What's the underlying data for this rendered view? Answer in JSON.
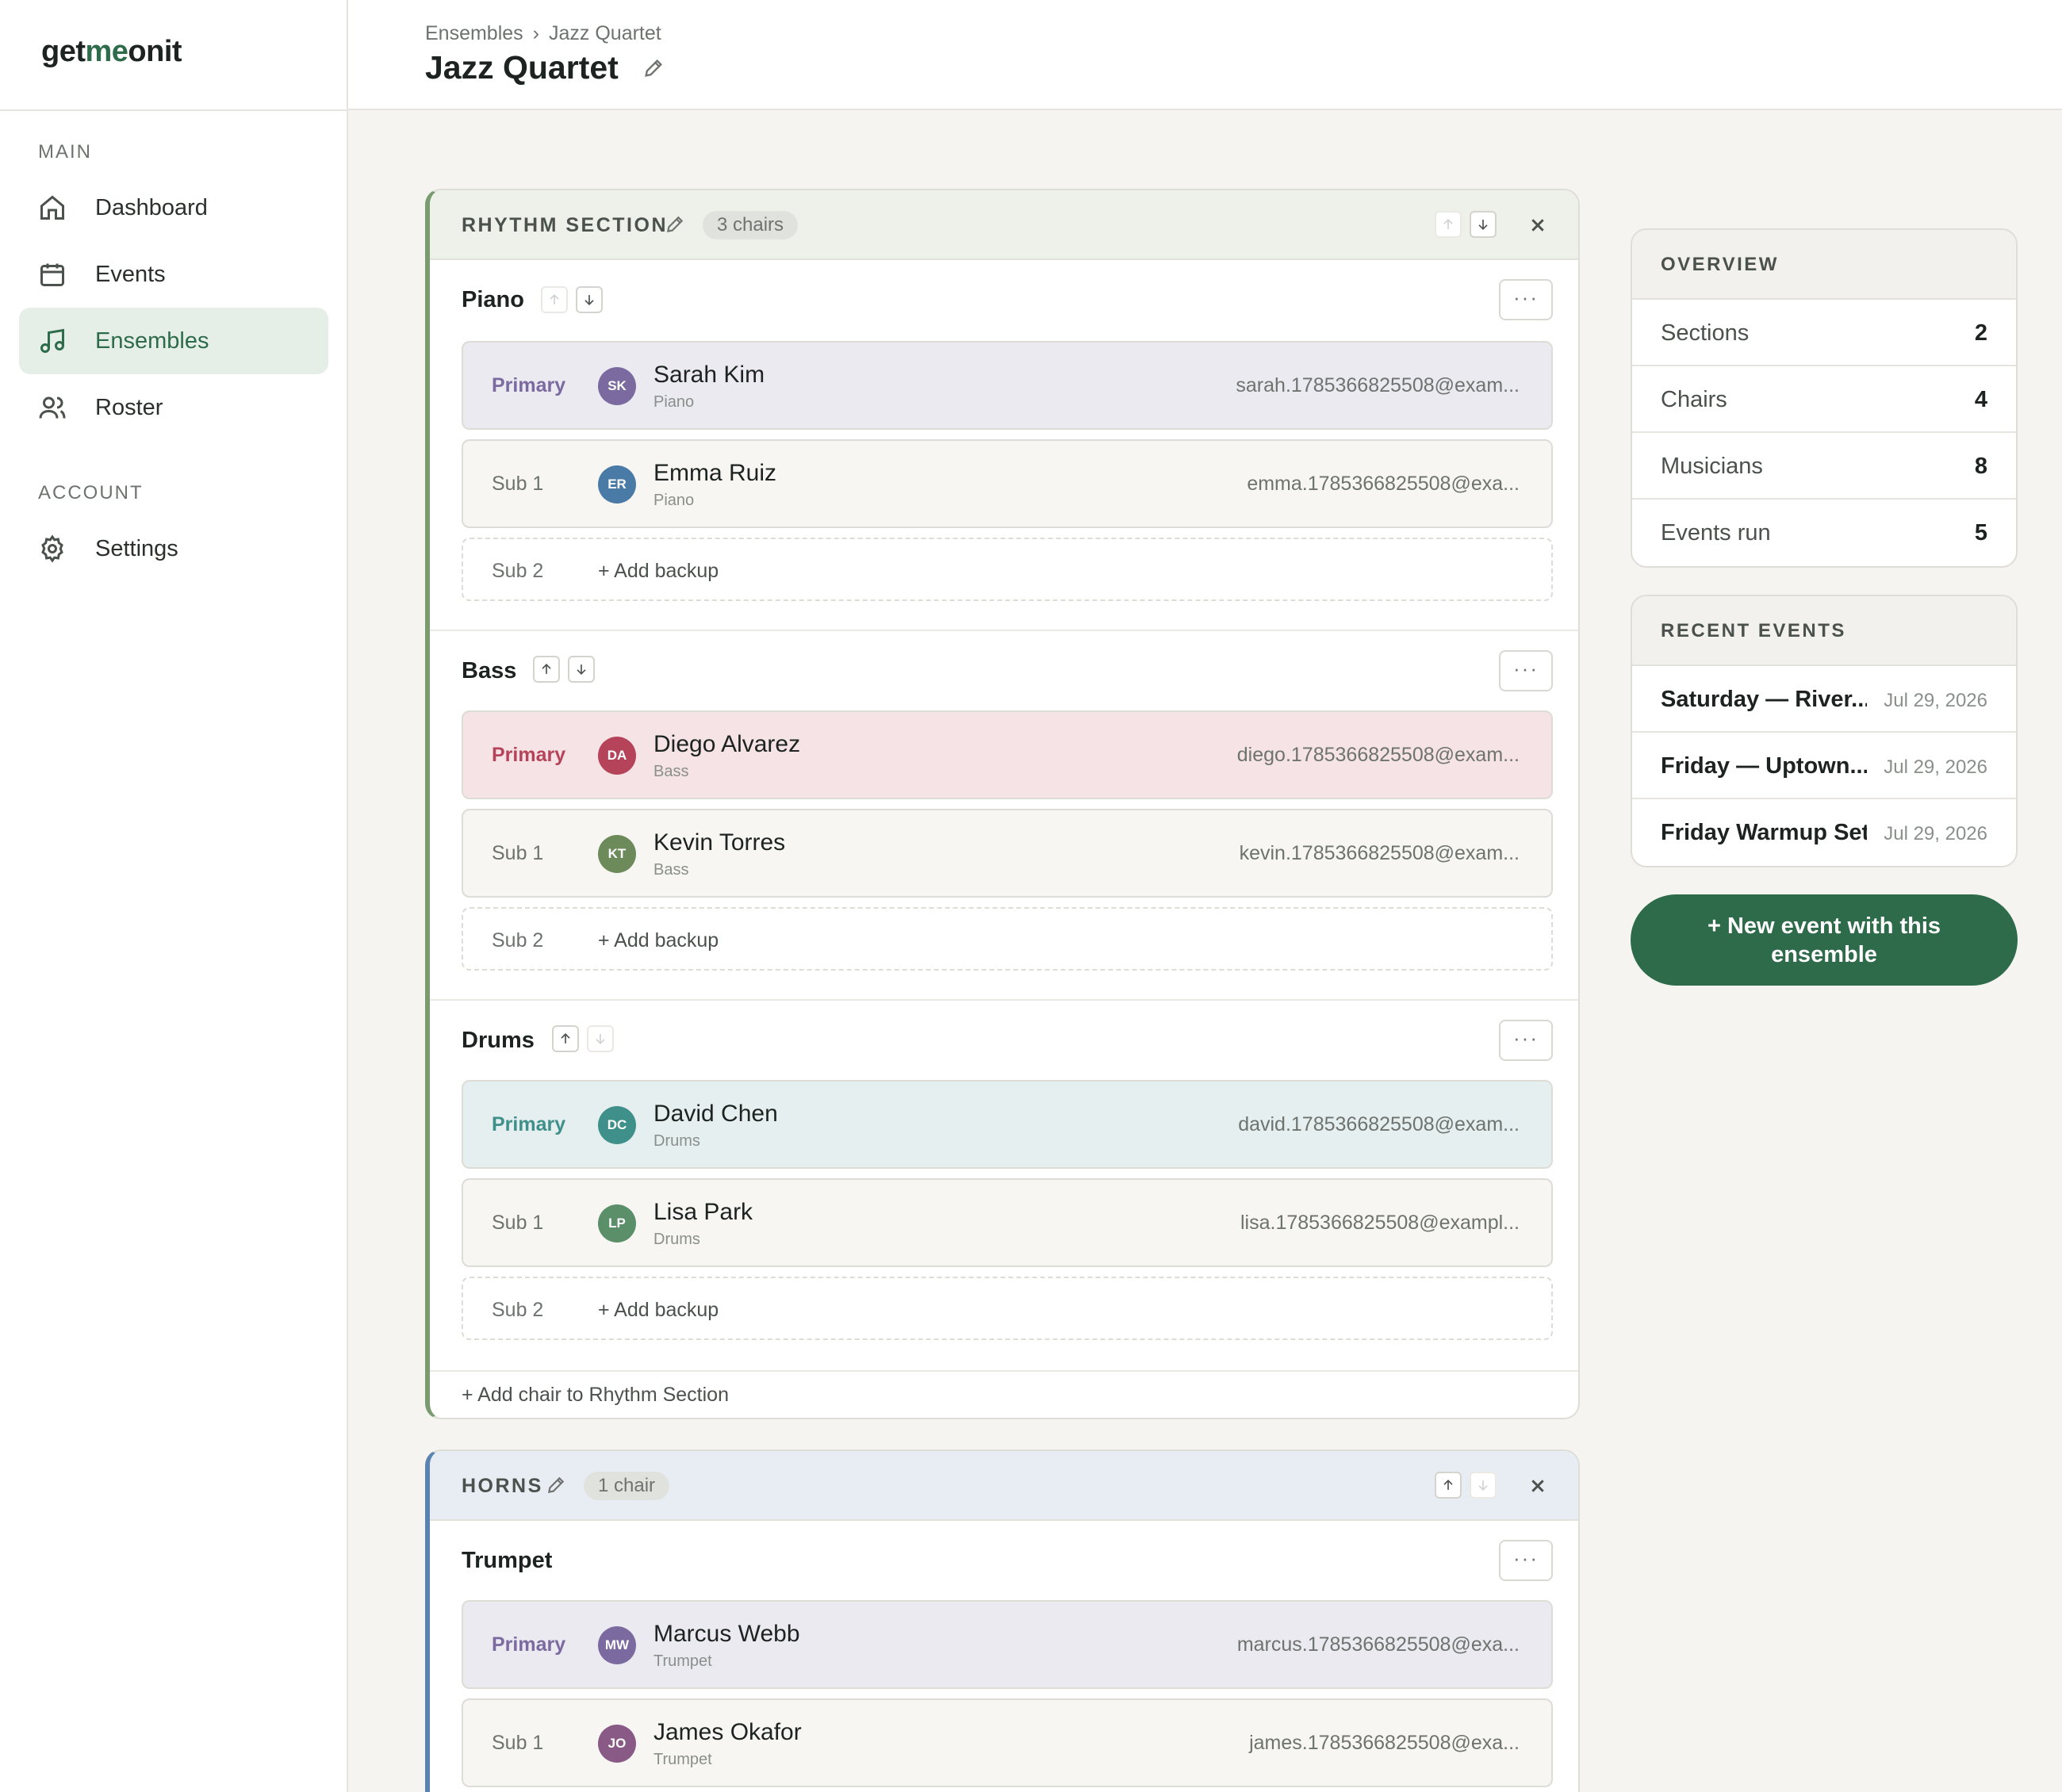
{
  "app": {
    "logo_pre": "get",
    "logo_mid": "me",
    "logo_post": "onit"
  },
  "sidebar": {
    "main_label": "MAIN",
    "account_label": "ACCOUNT",
    "items": [
      {
        "label": "Dashboard",
        "icon": "home-icon"
      },
      {
        "label": "Events",
        "icon": "calendar-icon"
      },
      {
        "label": "Ensembles",
        "icon": "music-note-icon",
        "active": true
      },
      {
        "label": "Roster",
        "icon": "users-icon"
      },
      {
        "label": "Settings",
        "icon": "gear-icon"
      }
    ]
  },
  "header": {
    "breadcrumb": [
      "Ensembles",
      "Jazz Quartet"
    ],
    "title": "Jazz Quartet"
  },
  "sections": [
    {
      "title": "RHYTHM SECTION",
      "count": "3 chairs",
      "accent": "#7a9a6f",
      "add_chair": "+ Add chair to Rhythm Section",
      "chairs": [
        {
          "name": "Piano",
          "seats": [
            {
              "role": "Primary",
              "initials": "SK",
              "name": "Sarah Kim",
              "instrument": "Piano",
              "email": "sarah.1785366825508@exam...",
              "color": "#7b6aa0"
            },
            {
              "role": "Sub 1",
              "initials": "ER",
              "name": "Emma Ruiz",
              "instrument": "Piano",
              "email": "emma.1785366825508@exa...",
              "color": "#4a7aa6"
            },
            {
              "role": "Sub 2",
              "add": "+ Add backup"
            }
          ]
        },
        {
          "name": "Bass",
          "seats": [
            {
              "role": "Primary",
              "initials": "DA",
              "name": "Diego Alvarez",
              "instrument": "Bass",
              "email": "diego.1785366825508@exam...",
              "color": "#b5435a"
            },
            {
              "role": "Sub 1",
              "initials": "KT",
              "name": "Kevin Torres",
              "instrument": "Bass",
              "email": "kevin.1785366825508@exam...",
              "color": "#6d8a5a"
            },
            {
              "role": "Sub 2",
              "add": "+ Add backup"
            }
          ]
        },
        {
          "name": "Drums",
          "seats": [
            {
              "role": "Primary",
              "initials": "DC",
              "name": "David Chen",
              "instrument": "Drums",
              "email": "david.1785366825508@exam...",
              "color": "#3f8f8a"
            },
            {
              "role": "Sub 1",
              "initials": "LP",
              "name": "Lisa Park",
              "instrument": "Drums",
              "email": "lisa.1785366825508@exampl...",
              "color": "#5a8f6a"
            },
            {
              "role": "Sub 2",
              "add": "+ Add backup"
            }
          ]
        }
      ]
    },
    {
      "title": "HORNS",
      "count": "1 chair",
      "accent": "#5b83b0",
      "chairs": [
        {
          "name": "Trumpet",
          "seats": [
            {
              "role": "Primary",
              "initials": "MW",
              "name": "Marcus Webb",
              "instrument": "Trumpet",
              "email": "marcus.1785366825508@exa...",
              "color": "#7b6aa0"
            },
            {
              "role": "Sub 1",
              "initials": "JO",
              "name": "James Okafor",
              "instrument": "Trumpet",
              "email": "james.1785366825508@exa...",
              "color": "#8a5a86"
            }
          ]
        }
      ]
    }
  ],
  "overview": {
    "title": "OVERVIEW",
    "rows": [
      {
        "label": "Sections",
        "value": "2"
      },
      {
        "label": "Chairs",
        "value": "4"
      },
      {
        "label": "Musicians",
        "value": "8"
      },
      {
        "label": "Events run",
        "value": "5"
      }
    ]
  },
  "recent": {
    "title": "RECENT EVENTS",
    "rows": [
      {
        "name": "Saturday — River...",
        "date": "Jul 29, 2026"
      },
      {
        "name": "Friday — Uptown...",
        "date": "Jul 29, 2026"
      },
      {
        "name": "Friday Warmup Set",
        "date": "Jul 29, 2026"
      }
    ]
  },
  "cta": "+ New event with this ensemble",
  "colors": {
    "brand": "#2e6b4a",
    "active_nav_bg": "#e6efe7"
  }
}
